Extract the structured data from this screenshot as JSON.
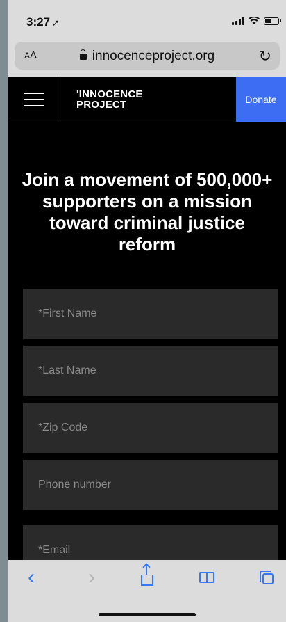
{
  "status_bar": {
    "time": "3:27",
    "location_glyph": "➚"
  },
  "browser": {
    "text_size_label_small": "A",
    "text_size_label_large": "A",
    "url": "innocenceproject.org",
    "reload_glyph": "↻"
  },
  "site_header": {
    "logo_line1": "'INNOCENCE",
    "logo_line2": "PROJECT",
    "donate_label": "Donate"
  },
  "headline": "Join a movement of 500,000+ supporters on a mission toward criminal justice reform",
  "form": {
    "first_name_placeholder": "*First Name",
    "last_name_placeholder": "*Last Name",
    "zip_placeholder": "*Zip Code",
    "phone_placeholder": "Phone number",
    "email_placeholder": "*Email"
  },
  "toolbar": {
    "back_glyph": "‹",
    "forward_glyph": "›"
  },
  "colors": {
    "donate": "#3d6df2",
    "safari_blue": "#3478f6",
    "field_bg": "#2a2a2a"
  }
}
